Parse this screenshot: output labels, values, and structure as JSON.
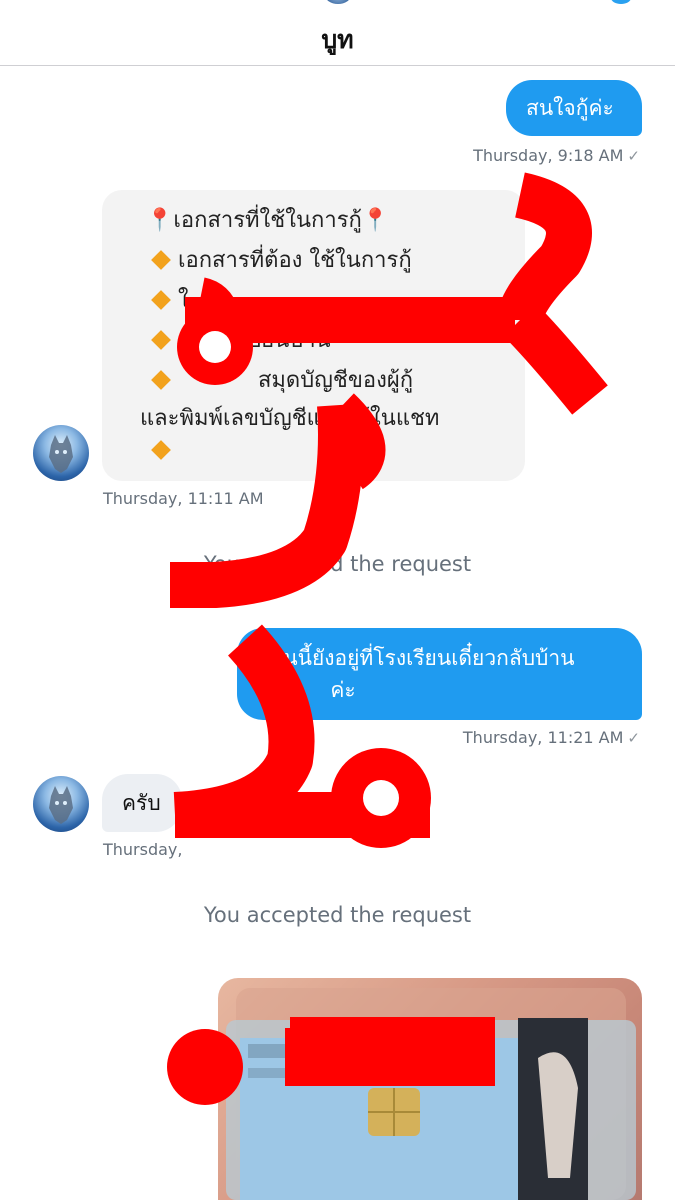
{
  "header": {
    "title": "บูท"
  },
  "messages": {
    "m1": {
      "text": "สนใจกู้ค่ะ",
      "time": "Thursday, 9:18 AM",
      "status": "✓"
    },
    "img1": {
      "lines": [
        "เอกสารที่ใช้ในการกู้",
        "เอกสารที่ต้อง ใช้ในการกู้",
        "ใ",
        "ะเบียนบ้าน",
        "สมุดบัญชีของผู้กู้",
        "และพิมพ์เลขบัญชีแปะไว้ในแชท",
        ""
      ],
      "time": "Thursday, 11:11 AM"
    },
    "sys1": "You accepted the request",
    "m2": {
      "line1": "ตอนนี้ยังอยู่ที่โรงเรียนเดี๋ยวกลับบ้าน",
      "line2": "ส่งใ",
      "line2b": "ค่ะ",
      "time": "Thursday, 11:21 AM",
      "status": "✓"
    },
    "m3": {
      "text": "ครับ",
      "time": "Thursday,"
    },
    "sys2": "You accepted the request"
  },
  "icons": {
    "pin": "map-pin-icon",
    "diamond": "orange-diamond-icon",
    "read": "checkmark-icon"
  },
  "colors": {
    "outgoing_bubble": "#1f9bf0",
    "incoming_bubble": "#eceff3",
    "overlay_red": "#ff0000"
  }
}
